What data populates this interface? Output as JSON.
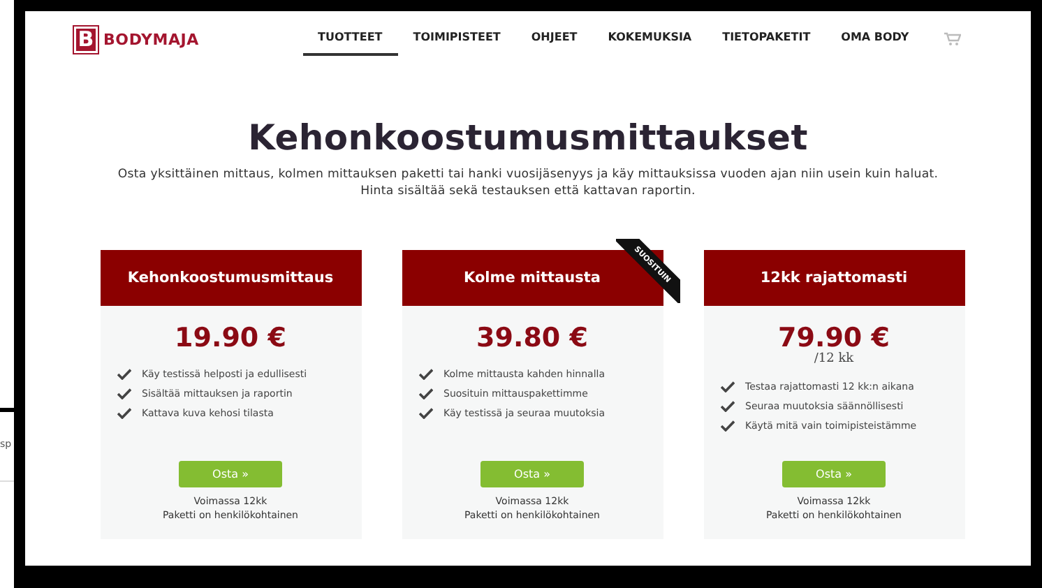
{
  "background_fragment": "sp",
  "brand": {
    "logo_letter": "B",
    "name": "BODYMAJA"
  },
  "nav": [
    {
      "label": "TUOTTEET",
      "selected": true
    },
    {
      "label": "TOIMIPISTEET",
      "selected": false
    },
    {
      "label": "OHJEET",
      "selected": false
    },
    {
      "label": "KOKEMUKSIA",
      "selected": false
    },
    {
      "label": "TIETOPAKETIT",
      "selected": false
    },
    {
      "label": "OMA BODY",
      "selected": false
    }
  ],
  "heading": "Kehonkoostumusmittaukset",
  "intro": "Osta yksittäinen mittaus, kolmen mittauksen paketti tai hanki vuosijäsenyys ja käy mittauksissa vuoden ajan niin usein kuin haluat. Hinta sisältää sekä testauksen että kattavan raportin.",
  "plans": [
    {
      "title": "Kehonkoostumusmittaus",
      "price": "19.90 €",
      "features": [
        "Käy testissä helposti ja edullisesti",
        "Sisältää mittauksen ja raportin",
        "Kattava kuva kehosi tilasta"
      ],
      "button": "Osta »",
      "notes": [
        "Voimassa 12kk",
        "Paketti on henkilökohtainen"
      ]
    },
    {
      "title": "Kolme mittausta",
      "ribbon": "SUOSITUIN",
      "price": "39.80 €",
      "features": [
        "Kolme mittausta kahden hinnalla",
        "Suosituin mittauspakettimme",
        "Käy testissä ja seuraa muutoksia"
      ],
      "button": "Osta »",
      "notes": [
        "Voimassa 12kk",
        "Paketti on henkilökohtainen"
      ]
    },
    {
      "title": "12kk rajattomasti",
      "price": "79.90 €",
      "period": "/12 kk",
      "features": [
        "Testaa rajattomasti 12 kk:n aikana",
        "Seuraa muutoksia säännöllisesti",
        "Käytä mitä vain toimipisteistämme"
      ],
      "button": "Osta »",
      "notes": [
        "Voimassa 12kk",
        "Paketti on henkilökohtainen"
      ]
    }
  ]
}
